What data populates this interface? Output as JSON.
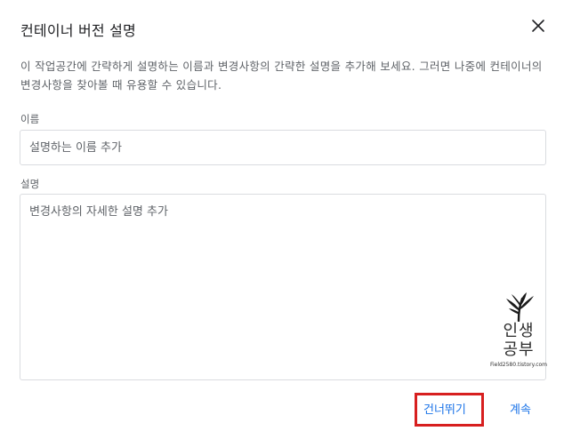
{
  "dialog": {
    "title": "컨테이너 버전 설명",
    "description": "이 작업공간에 간략하게 설명하는 이름과 변경사항의 간략한 설명을 추가해 보세요. 그러면 나중에 컨테이너의 변경사항을 찾아볼 때 유용할 수 있습니다.",
    "name_label": "이름",
    "name_placeholder": "설명하는 이름 추가",
    "desc_label": "설명",
    "desc_placeholder": "변경사항의 자세한 설명 추가",
    "skip_label": "건너뛰기",
    "continue_label": "계속"
  },
  "watermark": {
    "line1": "인생",
    "line2": "공부",
    "url": "Field2580.tistory.com"
  },
  "icons": {
    "close": "close-icon",
    "plant": "plant-icon"
  },
  "colors": {
    "accent": "#1a73e8",
    "highlight": "#d71f1f",
    "border": "#dadce0",
    "secondary_text": "#5f6368"
  }
}
